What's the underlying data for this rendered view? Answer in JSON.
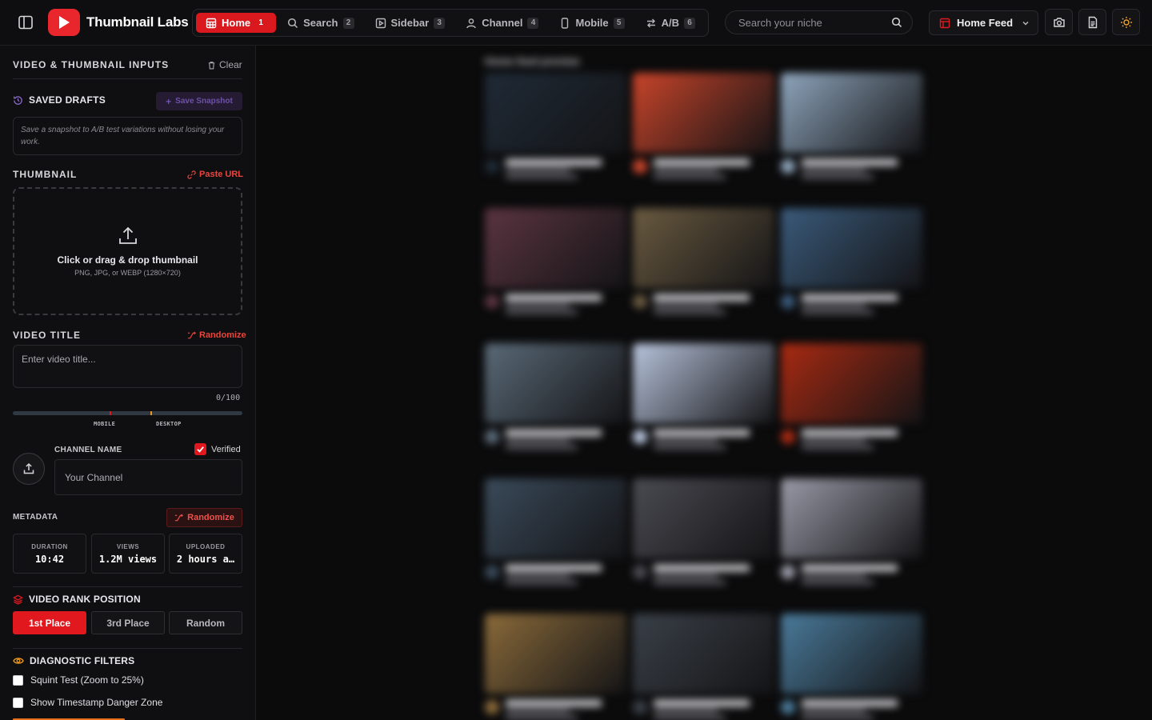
{
  "app": {
    "name": "Thumbnail Labs",
    "brand_color": "#e1191f"
  },
  "nav": {
    "tabs": [
      {
        "label": "Home",
        "count": "1",
        "icon": "grid-icon",
        "active": true
      },
      {
        "label": "Search",
        "count": "2",
        "icon": "search-icon",
        "active": false
      },
      {
        "label": "Sidebar",
        "count": "3",
        "icon": "play-square-icon",
        "active": false
      },
      {
        "label": "Channel",
        "count": "4",
        "icon": "user-icon",
        "active": false
      },
      {
        "label": "Mobile",
        "count": "5",
        "icon": "smartphone-icon",
        "active": false
      },
      {
        "label": "A/B",
        "count": "6",
        "icon": "swap-icon",
        "active": false
      }
    ]
  },
  "search": {
    "placeholder": "Search your niche"
  },
  "view_select": {
    "value": "Home Feed"
  },
  "toolbar": {
    "icons": [
      "camera-icon",
      "document-icon",
      "sun-icon"
    ]
  },
  "panel": {
    "title": "Video & Thumbnail Inputs",
    "clear_label": "Clear",
    "drafts": {
      "title": "Saved Drafts",
      "save_label": "Save Snapshot",
      "note": "Save a snapshot to A/B test variations without losing your work."
    },
    "thumbnail": {
      "title": "Thumbnail",
      "paste_label": "Paste URL",
      "drop_title": "Click or drag & drop thumbnail",
      "drop_hint": "PNG, JPG, or WEBP (1280×720)"
    },
    "video_title": {
      "title": "Video Title",
      "randomize_label": "Randomize",
      "placeholder": "Enter video title...",
      "value": "",
      "counter": "0/100",
      "mobile_label": "MOBILE",
      "desktop_label": "DESKTOP",
      "mobile_fraction": 0.42,
      "desktop_fraction": 0.6
    },
    "channel": {
      "label": "Channel Name",
      "verified_label": "Verified",
      "verified": true,
      "placeholder": "Your Channel"
    },
    "metadata": {
      "label": "Metadata",
      "randomize_label": "Randomize",
      "fields": [
        {
          "key": "DURATION",
          "value": "10:42"
        },
        {
          "key": "VIEWS",
          "value": "1.2M views"
        },
        {
          "key": "UPLOADED",
          "value": "2 hours a…"
        }
      ]
    },
    "rank": {
      "title": "Video Rank Position",
      "options": [
        "1st Place",
        "3rd Place",
        "Random"
      ],
      "selected": "1st Place"
    },
    "diagnostics": {
      "title": "Diagnostic Filters",
      "options": [
        {
          "label": "Squint Test (Zoom to 25%)",
          "checked": false
        },
        {
          "label": "Show Timestamp Danger Zone",
          "checked": false
        }
      ]
    }
  },
  "feed": {
    "heading": "Home feed preview",
    "thumb_colors": [
      "#1f2a36",
      "#c8442a",
      "#8fa6bd",
      "#5a3440",
      "#6a5a40",
      "#3a5a7a",
      "#5a6a78",
      "#b8c4dc",
      "#a82a12",
      "#3a4a5a",
      "#4a4a52",
      "#9a9aa8",
      "#8a6a3a",
      "#3a4048",
      "#4a7a9a"
    ]
  }
}
